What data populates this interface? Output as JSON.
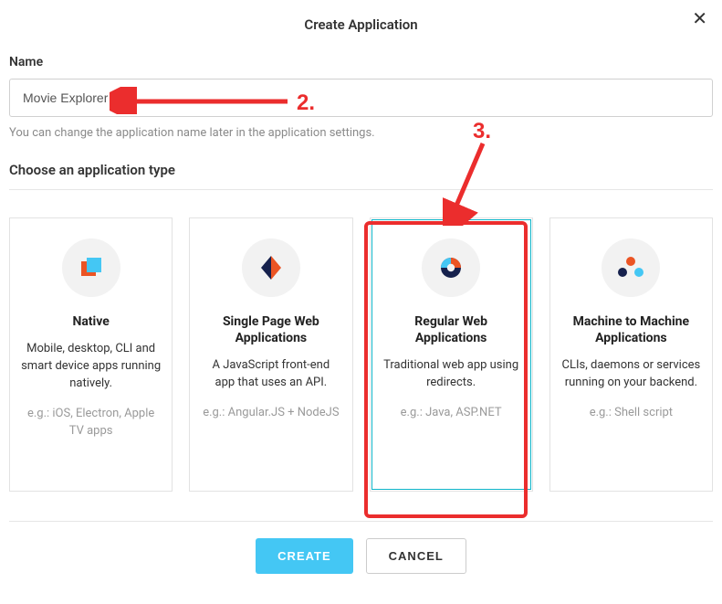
{
  "dialog": {
    "title": "Create Application",
    "close_symbol": "✕"
  },
  "name_field": {
    "label": "Name",
    "value": "Movie Explorer",
    "helper": "You can change the application name later in the application settings."
  },
  "type_section": {
    "title": "Choose an application type"
  },
  "cards": [
    {
      "icon": "native-icon",
      "title": "Native",
      "desc": "Mobile, desktop, CLI and smart device apps running natively.",
      "eg": "e.g.: iOS, Electron, Apple TV apps",
      "selected": false
    },
    {
      "icon": "spa-icon",
      "title": "Single Page Web Applications",
      "desc": "A JavaScript front-end app that uses an API.",
      "eg": "e.g.: Angular.JS + NodeJS",
      "selected": false
    },
    {
      "icon": "web-icon",
      "title": "Regular Web Applications",
      "desc": "Traditional web app using redirects.",
      "eg": "e.g.: Java, ASP.NET",
      "selected": true
    },
    {
      "icon": "m2m-icon",
      "title": "Machine to Machine Applications",
      "desc": "CLIs, daemons or services running on your backend.",
      "eg": "e.g.: Shell script",
      "selected": false
    }
  ],
  "footer": {
    "create": "Create",
    "cancel": "Cancel"
  },
  "annotations": {
    "step2": "2.",
    "step3": "3."
  }
}
